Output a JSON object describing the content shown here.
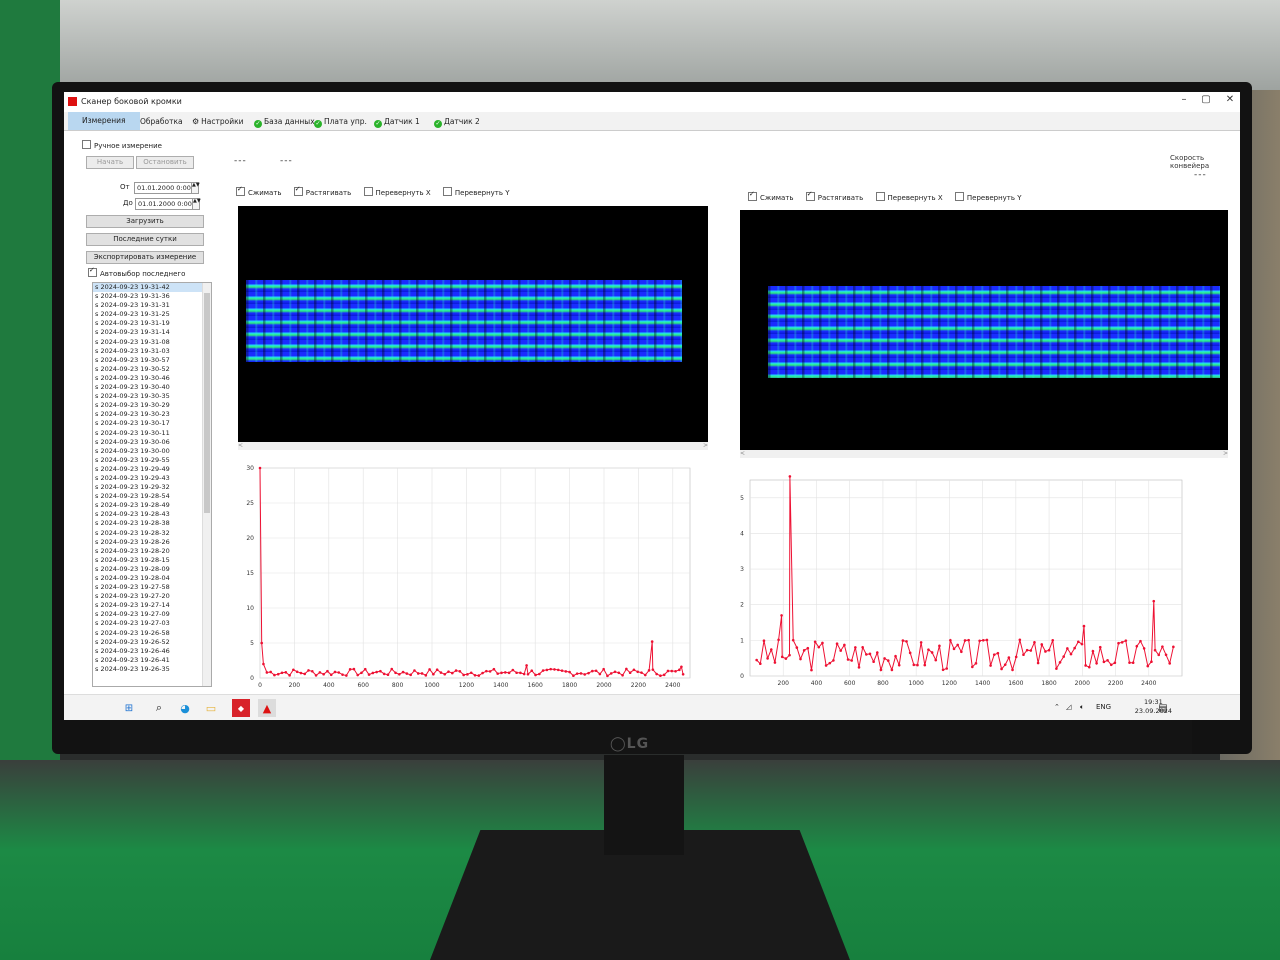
{
  "window": {
    "title": "Сканер боковой кромки"
  },
  "tabs": [
    {
      "label": "Измерения",
      "active": true
    },
    {
      "label": "Обработка"
    },
    {
      "label": "Настройки",
      "icon": "gear-icon"
    },
    {
      "label": "База данных",
      "status": "ok"
    },
    {
      "label": "Плата упр.",
      "status": "ok"
    },
    {
      "label": "Датчик 1",
      "status": "ok"
    },
    {
      "label": "Датчик 2",
      "status": "ok"
    }
  ],
  "left_panel": {
    "manual_measure": "Ручное измерение",
    "start": "Начать",
    "stop": "Остановить",
    "from_label": "От",
    "to_label": "До",
    "from_value": "01.01.2000 0:00",
    "to_value": "01.01.2000 0:00",
    "load": "Загрузить",
    "last_day": "Последние сутки",
    "export": "Экспортировать измерение",
    "autoselect": "Автовыбор последнего",
    "list": [
      "s 2024-09-23  19-31-42",
      "s 2024-09-23  19-31-36",
      "s 2024-09-23  19-31-31",
      "s 2024-09-23  19-31-25",
      "s 2024-09-23  19-31-19",
      "s 2024-09-23  19-31-14",
      "s 2024-09-23  19-31-08",
      "s 2024-09-23  19-31-03",
      "s 2024-09-23  19-30-57",
      "s 2024-09-23  19-30-52",
      "s 2024-09-23  19-30-46",
      "s 2024-09-23  19-30-40",
      "s 2024-09-23  19-30-35",
      "s 2024-09-23  19-30-29",
      "s 2024-09-23  19-30-23",
      "s 2024-09-23  19-30-17",
      "s 2024-09-23  19-30-11",
      "s 2024-09-23  19-30-06",
      "s 2024-09-23  19-30-00",
      "s 2024-09-23  19-29-55",
      "s 2024-09-23  19-29-49",
      "s 2024-09-23  19-29-43",
      "s 2024-09-23  19-29-32",
      "s 2024-09-23  19-28-54",
      "s 2024-09-23  19-28-49",
      "s 2024-09-23  19-28-43",
      "s 2024-09-23  19-28-38",
      "s 2024-09-23  19-28-32",
      "s 2024-09-23  19-28-26",
      "s 2024-09-23  19-28-20",
      "s 2024-09-23  19-28-15",
      "s 2024-09-23  19-28-09",
      "s 2024-09-23  19-28-04",
      "s 2024-09-23  19-27-58",
      "s 2024-09-23  19-27-20",
      "s 2024-09-23  19-27-14",
      "s 2024-09-23  19-27-09",
      "s 2024-09-23  19-27-03",
      "s 2024-09-23  19-26-58",
      "s 2024-09-23  19-26-52",
      "s 2024-09-23  19-26-46",
      "s 2024-09-23  19-26-41",
      "s 2024-09-23  19-26-35"
    ]
  },
  "main": {
    "dash1": "---",
    "dash2": "---",
    "conveyor_speed_label": "Скорость конвейера",
    "conveyor_speed_value": "---",
    "options": {
      "compress": "Сжимать",
      "stretch": "Растягивать",
      "flip_x": "Перевернуть X",
      "flip_y": "Перевернуть Y"
    },
    "hscroll_left": "<",
    "hscroll_right": ">"
  },
  "taskbar": {
    "lang": "ENG",
    "time": "19:31",
    "date": "23.09.2024"
  },
  "colors": {
    "accent_tab": "#b9d7f0",
    "status_ok": "#2ab32a",
    "series": "#ee1133"
  },
  "chart_data": [
    {
      "type": "line",
      "xlim": [
        0,
        2500
      ],
      "ylim": [
        0,
        30
      ],
      "xticks": [
        0,
        200,
        400,
        600,
        800,
        1000,
        1200,
        1400,
        1600,
        1800,
        2000,
        2200,
        2400
      ],
      "yticks": [
        0,
        5,
        10,
        15,
        20,
        25,
        30
      ],
      "grid": true,
      "baseline_seed": 7,
      "baseline": 0.8,
      "noise": 0.5,
      "peaks": [
        [
          0,
          30
        ],
        [
          10,
          5
        ],
        [
          20,
          2
        ],
        [
          1550,
          1.8
        ],
        [
          2280,
          5.2
        ],
        [
          2450,
          1.6
        ]
      ]
    },
    {
      "type": "line",
      "xlim": [
        0,
        2600
      ],
      "ylim": [
        0,
        5.5
      ],
      "xticks": [
        200,
        400,
        600,
        800,
        1000,
        1200,
        1400,
        1600,
        1800,
        2000,
        2200,
        2400
      ],
      "yticks": [
        0,
        1,
        2,
        3,
        4,
        5
      ],
      "grid": true,
      "baseline_seed": 3,
      "baseline": 0.6,
      "noise": 0.45,
      "peaks": [
        [
          190,
          1.7
        ],
        [
          240,
          5.6
        ],
        [
          2010,
          1.4
        ],
        [
          2430,
          2.1
        ]
      ]
    }
  ]
}
